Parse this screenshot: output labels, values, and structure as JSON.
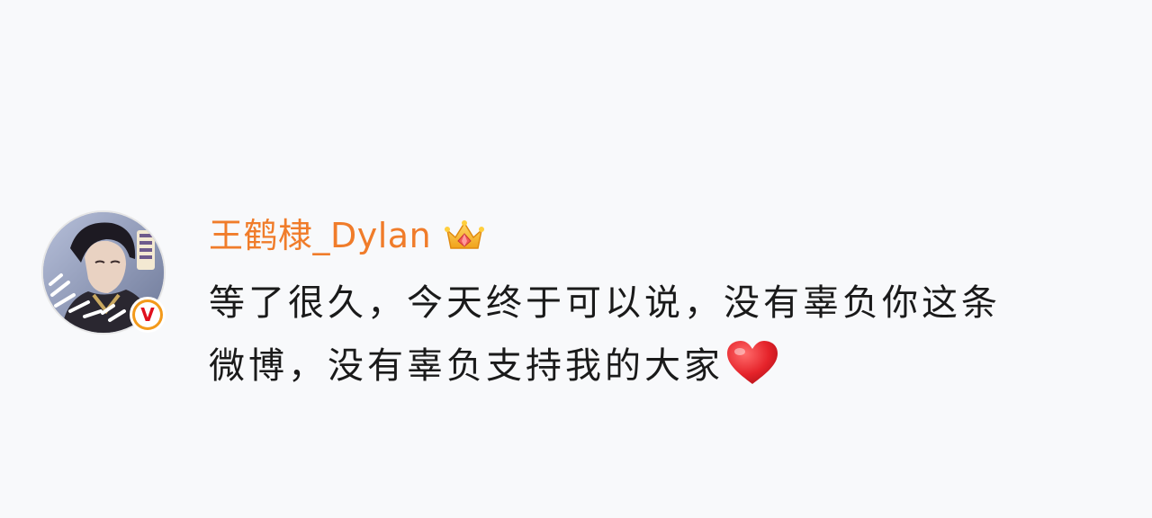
{
  "post": {
    "author": {
      "name": "王鹤棣_Dylan",
      "avatar_icon": "avatar-portrait",
      "badge_icon": "verified-v-icon",
      "badge_letter": "V",
      "crown_icon": "crown-icon",
      "name_color": "#f07c2a",
      "badge_color": "#f39a1b"
    },
    "text": {
      "line1": "等了很久，今天终于可以说，没有辜负你这条",
      "line2": "微博，没有辜负支持我的大家"
    },
    "emoji_icon": "red-heart-icon",
    "heart_color": "#e5232a"
  }
}
